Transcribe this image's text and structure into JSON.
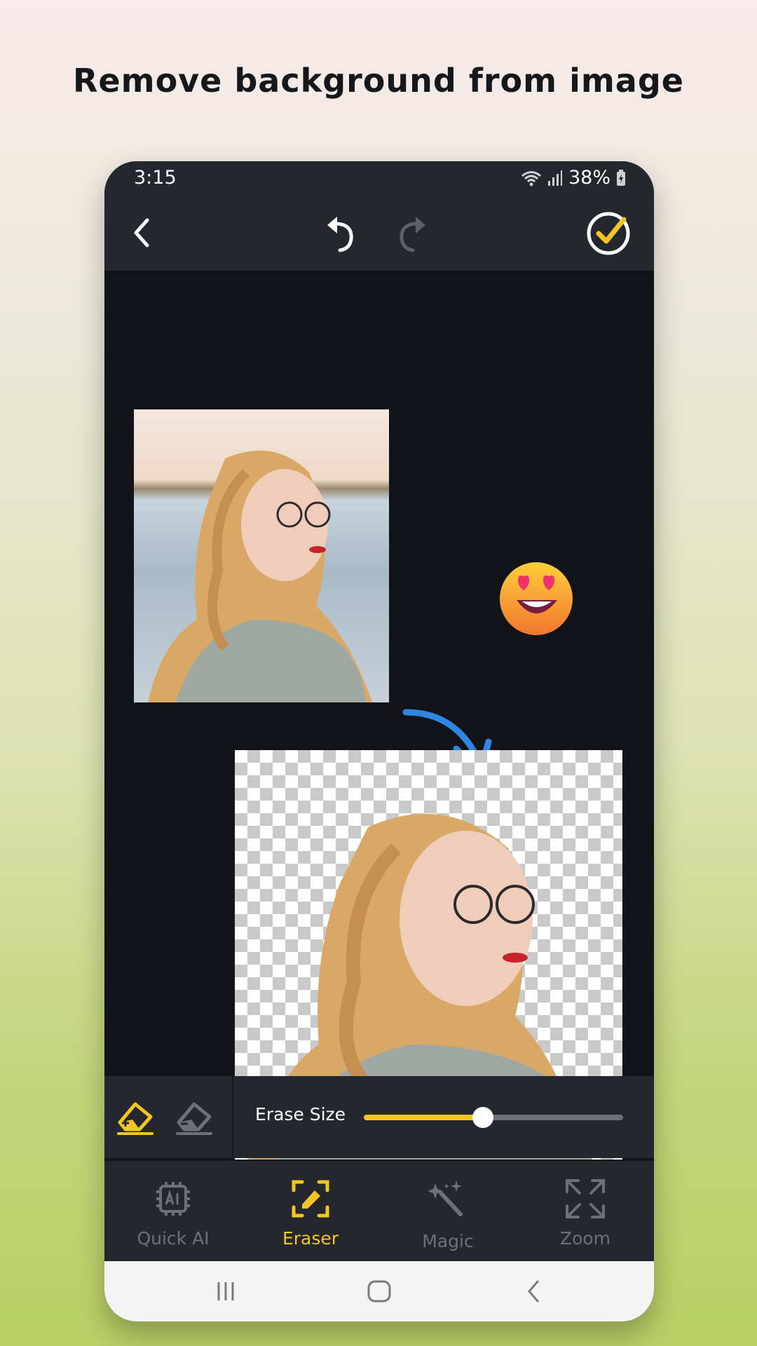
{
  "headline": "Remove background from image",
  "status": {
    "time": "3:15",
    "battery": "38%"
  },
  "icons": {
    "back": "back-arrow-icon",
    "undo": "undo-icon",
    "redo": "redo-icon",
    "confirm": "check-circle-icon"
  },
  "tools": {
    "erase_size_label": "Erase Size",
    "erase_size_fraction": 0.46
  },
  "tabs": [
    {
      "label": "Quick AI",
      "icon": "ai-chip-icon",
      "active": false
    },
    {
      "label": "Eraser",
      "icon": "eraser-icon",
      "active": true
    },
    {
      "label": "Magic",
      "icon": "magic-wand-icon",
      "active": false
    },
    {
      "label": "Zoom",
      "icon": "zoom-expand-icon",
      "active": false
    }
  ],
  "colors": {
    "accent": "#f3c623",
    "toolbar": "#24272d",
    "canvas": "#121318",
    "arrow": "#2f86e0"
  }
}
